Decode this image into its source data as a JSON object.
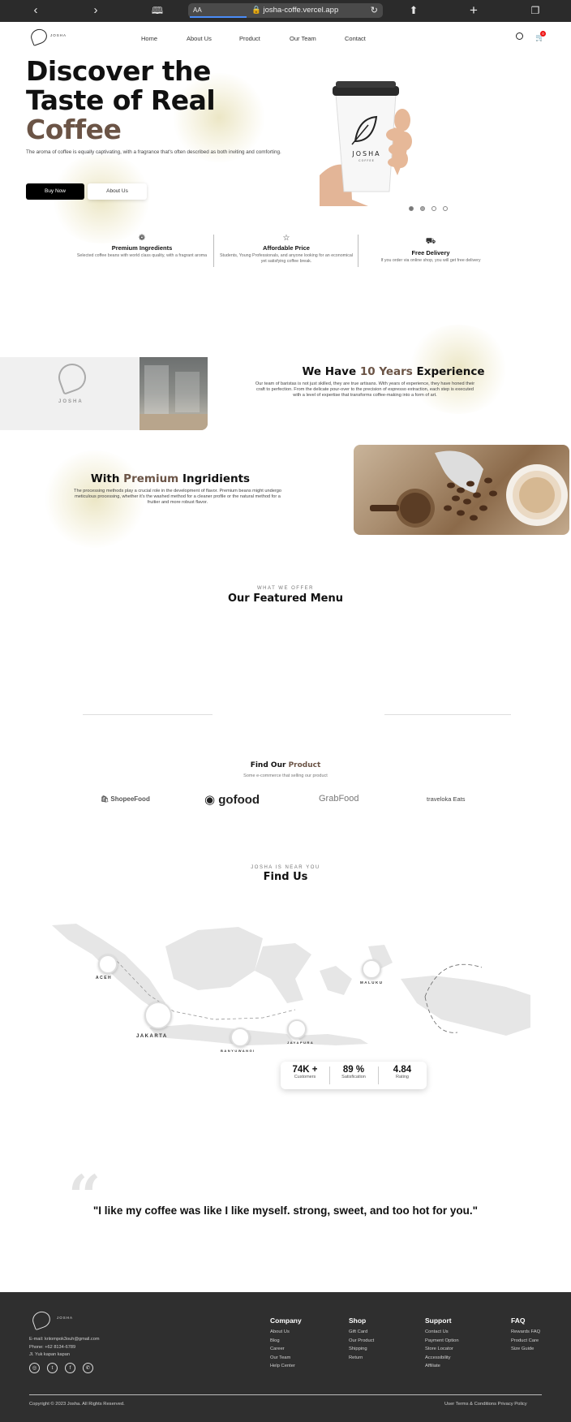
{
  "browser": {
    "text_size": "AA",
    "url": "josha-coffe.vercel.app"
  },
  "nav": {
    "logo_text": "JOSHA",
    "links": [
      "Home",
      "About Us",
      "Product",
      "Our Team",
      "Contact"
    ],
    "cart_count": "0"
  },
  "hero": {
    "title_line1": "Discover the",
    "title_line2": "Taste of Real",
    "title_line3": "Coffee",
    "description": "The aroma of coffee is equally captivating, with a fragrance that's often described as both inviting and comforting.",
    "buy_label": "Buy Now",
    "about_label": "About Us",
    "cup_brand": "JOSHA",
    "cup_sub": "COFFEE",
    "carousel_dots": 4
  },
  "features": [
    {
      "icon": "award-icon",
      "title": "Premium Ingredients",
      "desc": "Selected coffee beans with world class quality, with a fragrant aroma"
    },
    {
      "icon": "star-icon",
      "title": "Affordable Price",
      "desc": "Students, Young Professionals, and anyone looking for an economical yet satisfying coffee break."
    },
    {
      "icon": "truck-icon",
      "title": "Free Delivery",
      "desc": "If you order via online shop, you will get free delivery"
    }
  ],
  "experience": {
    "title_pre": "We Have ",
    "title_accent": "10 Years",
    "title_post": " Experience",
    "desc": "Our team of baristas is not just skilled, they are true artisans. With years of experience, they have honed their craft to perfection. From the delicate pour-over to the precision of espresso extraction, each step is executed with a level of expertise that transforms coffee-making into a form of art.",
    "logo_text": "JOSHA"
  },
  "ingredients": {
    "title_pre": "With ",
    "title_accent": "Premium",
    "title_post": " Ingridients",
    "desc": "The processing methods play a crucial role in the development of flavor. Premium beans might undergo meticulous processing, whether it's the washed method for a cleaner profile or the natural method for a fruitier and more robust flavor."
  },
  "menu": {
    "eyebrow": "WHAT WE OFFER",
    "title": "Our Featured Menu"
  },
  "product": {
    "title_pre": "Find Our ",
    "title_accent": "Product",
    "subtitle": "Some e-commerce that selling our product",
    "partners": [
      "ShopeeFood",
      "gofood",
      "GrabFood",
      "traveloka Eats"
    ]
  },
  "find_us": {
    "eyebrow": "JOSHA IS NEAR YOU",
    "title": "Find Us",
    "locations": [
      "ACEH",
      "JAKARTA",
      "BANYUWANGI",
      "JAYAPURA",
      "MALUKU"
    ],
    "stats": [
      {
        "value": "74K +",
        "label": "Customers"
      },
      {
        "value": "89 %",
        "label": "Satisfication"
      },
      {
        "value": "4.84",
        "label": "Rating"
      }
    ]
  },
  "quote": {
    "mark": "“",
    "text": "\"I like my coffee was like I like myself. strong, sweet, and too hot for you.\""
  },
  "footer": {
    "logo_text": "JOSHA",
    "email": "E-mail: kriiompok3ouh@gmail.com",
    "phone": "Phone: +62 8134-6789",
    "address": "Jl. Yuk kapan kapan",
    "social": [
      "instagram-icon",
      "twitter-icon",
      "facebook-icon",
      "whatsapp-icon"
    ],
    "columns": [
      {
        "title": "Company",
        "items": [
          "About Us",
          "Blog",
          "Career",
          "Our Team",
          "Help Center"
        ]
      },
      {
        "title": "Shop",
        "items": [
          "Gift Card",
          "Our Product",
          "Shipping",
          "Return"
        ]
      },
      {
        "title": "Support",
        "items": [
          "Contact Us",
          "Payment Option",
          "Store Locator",
          "Accessibility",
          "Affiliate"
        ]
      },
      {
        "title": "FAQ",
        "items": [
          "Rewards FAQ",
          "Product Care",
          "Size Guide"
        ]
      }
    ],
    "copyright": "Copyright © 2023 Josha. All Rights Reserved.",
    "legal": "User Terms & Conditions Privacy Policy"
  }
}
